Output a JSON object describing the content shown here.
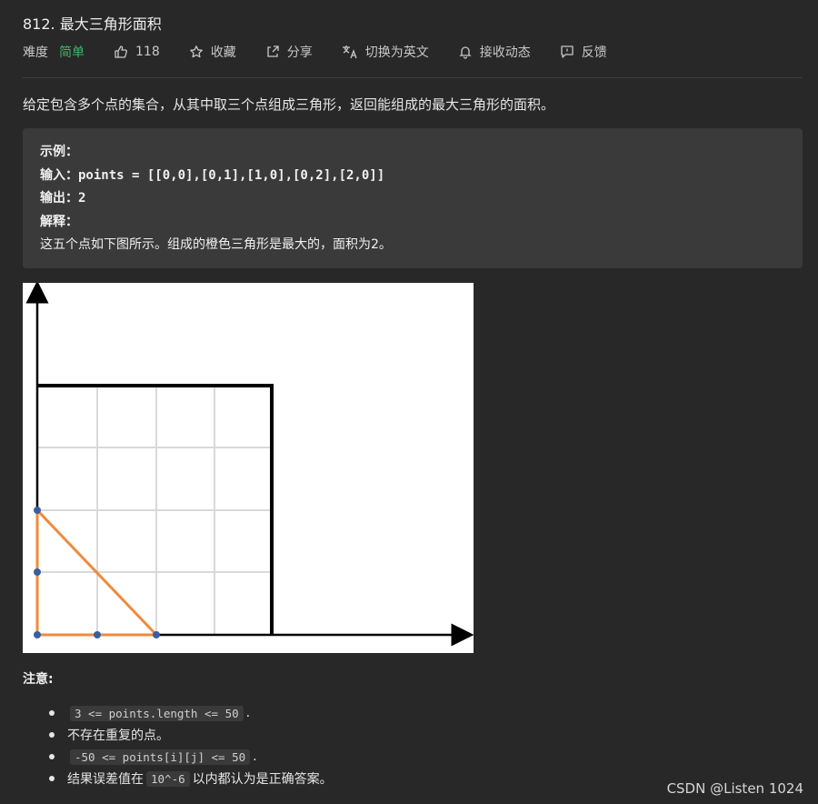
{
  "problem": {
    "title": "812. 最大三角形面积",
    "difficulty_label": "难度",
    "difficulty": "简单",
    "likes": "118",
    "actions": {
      "favorite": "收藏",
      "share": "分享",
      "translate": "切换为英文",
      "subscribe": "接收动态",
      "feedback": "反馈"
    },
    "description": "给定包含多个点的集合，从其中取三个点组成三角形，返回能组成的最大三角形的面积。",
    "example": {
      "heading": "示例：",
      "input_label": "输入：",
      "input_value": "points = [[0,0],[0,1],[1,0],[0,2],[2,0]]",
      "output_label": "输出：",
      "output_value": "2",
      "explain_label": "解释：",
      "explain_text": "这五个点如下图所示。组成的橙色三角形是最大的，面积为2。"
    },
    "notes_title": "注意:",
    "rules": [
      {
        "code": "3 <= points.length <= 50",
        "after": "."
      },
      {
        "text": "不存在重复的点。"
      },
      {
        "code": " -50 <= points[i][j] <= 50",
        "after": "."
      },
      {
        "before": "结果误差值在",
        "code": "10^-6",
        "after": "以内都认为是正确答案。"
      }
    ]
  },
  "watermark": "CSDN @Listen 1024",
  "colors": {
    "background": "#282828",
    "easy": "#3eb56a",
    "triangle": "#f08a3c",
    "point": "#3a5fa0"
  }
}
